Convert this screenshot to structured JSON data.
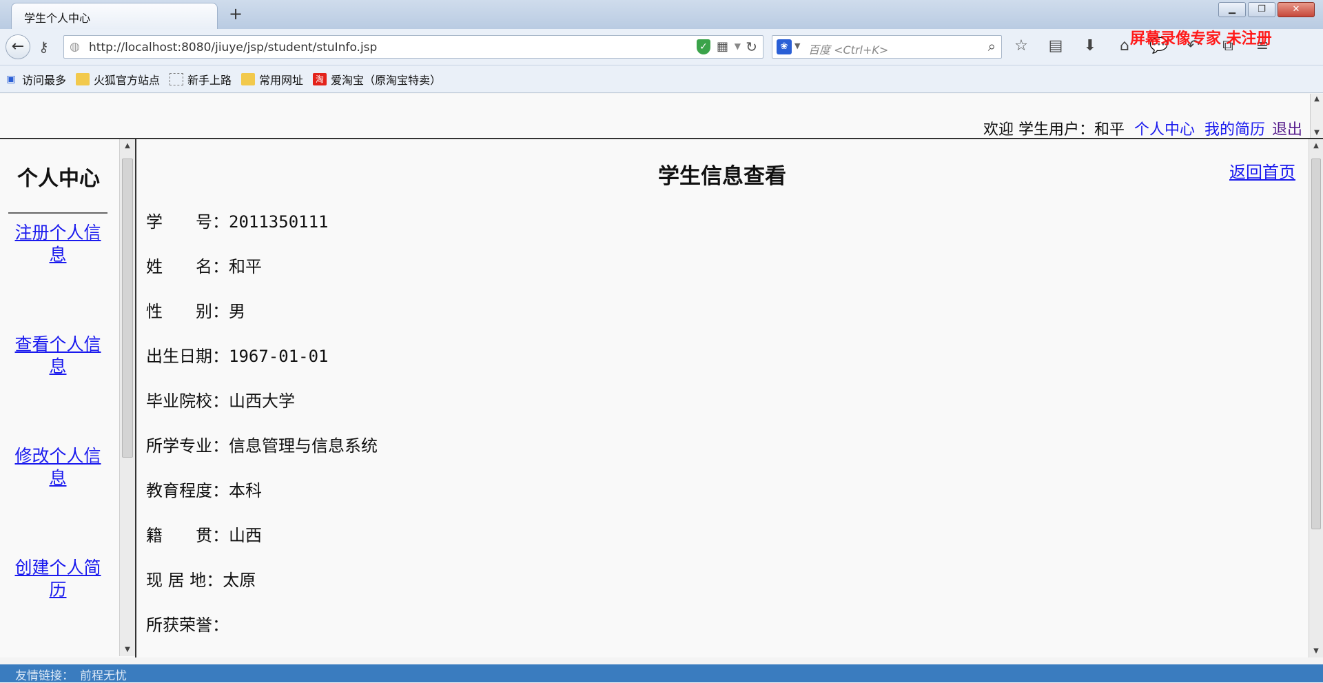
{
  "browser": {
    "tab_title": "学生个人中心",
    "url": "http://localhost:8080/jiuye/jsp/student/stuInfo.jsp",
    "search_placeholder": "百度 <Ctrl+K>",
    "watermark": "屏幕录像专家  未注册",
    "icons": [
      "star-icon",
      "reader-icon",
      "download-icon",
      "home-icon",
      "chat-icon",
      "undo-icon",
      "puzzle-icon",
      "menu-icon"
    ]
  },
  "bookmarks": [
    {
      "label": "访问最多",
      "icon": "most-visited-icon"
    },
    {
      "label": "火狐官方站点",
      "icon": "folder-icon"
    },
    {
      "label": "新手上路",
      "icon": "page-icon"
    },
    {
      "label": "常用网址",
      "icon": "folder-icon"
    },
    {
      "label": "爱淘宝（原淘宝特卖）",
      "icon": "taobao-icon"
    }
  ],
  "header": {
    "welcome_text": "欢迎  学生用户：和平",
    "personal_center": "个人中心",
    "my_resume": "我的简历",
    "logout": "退出"
  },
  "sidebar": {
    "title": "个人中心",
    "items": [
      {
        "label": "注册个人信息"
      },
      {
        "label": "查看个人信息"
      },
      {
        "label": "修改个人信息"
      },
      {
        "label": "创建个人简历"
      }
    ]
  },
  "main": {
    "title": "学生信息查看",
    "back_home": "返回首页",
    "fields": [
      {
        "label": "学　　号：",
        "value": "2011350111"
      },
      {
        "label": "姓　　名：",
        "value": "和平"
      },
      {
        "label": "性　　别：",
        "value": "男"
      },
      {
        "label": "出生日期：",
        "value": "1967-01-01"
      },
      {
        "label": "毕业院校：",
        "value": "山西大学"
      },
      {
        "label": "所学专业：",
        "value": "信息管理与信息系统"
      },
      {
        "label": "教育程度：",
        "value": "本科"
      },
      {
        "label": "籍　　贯：",
        "value": "山西"
      },
      {
        "label": "现 居 地：",
        "value": "太原"
      },
      {
        "label": "所获荣誉：",
        "value": ""
      }
    ]
  },
  "footer": {
    "label": "友情链接：",
    "link": "前程无忧"
  }
}
